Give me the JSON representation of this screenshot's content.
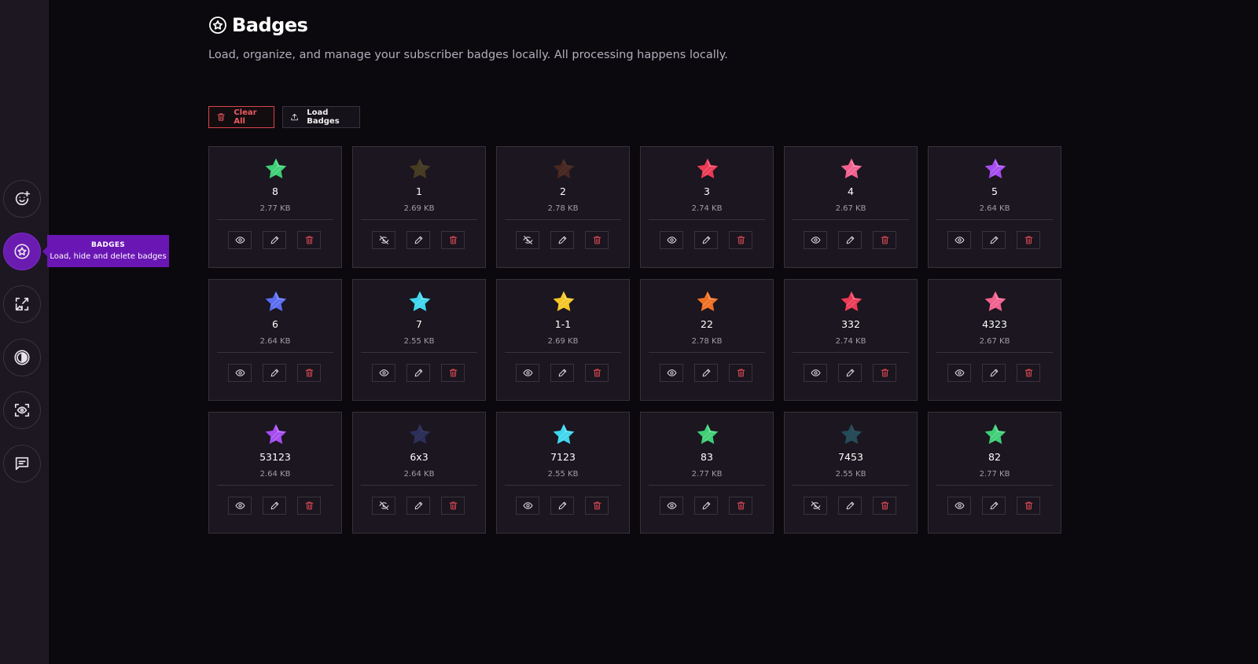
{
  "header": {
    "title": "Badges",
    "subtitle": "Load, organize, and manage your subscriber badges locally. All processing happens locally."
  },
  "toolbar": {
    "clear_label": "Clear All",
    "load_label": "Load Badges"
  },
  "tooltip": {
    "title": "BADGES",
    "subtitle": "Load, hide and delete badges"
  },
  "sidebar": {
    "items": [
      {
        "icon": "emoji-add-icon",
        "active": false
      },
      {
        "icon": "badge-star-icon",
        "active": true
      },
      {
        "icon": "image-resize-icon",
        "active": false
      },
      {
        "icon": "contrast-icon",
        "active": false
      },
      {
        "icon": "eye-scan-icon",
        "active": false
      },
      {
        "icon": "message-icon",
        "active": false
      }
    ]
  },
  "colors": {
    "accent": "#6a16b4",
    "danger": "#ee5a62",
    "background": "#0b090d",
    "card": "#1b161f"
  },
  "badges": [
    {
      "name": "8",
      "size": "2.77 KB",
      "color": "#3ecf76",
      "hidden": false
    },
    {
      "name": "1",
      "size": "2.69 KB",
      "color": "#b89a2a",
      "hidden": true
    },
    {
      "name": "2",
      "size": "2.78 KB",
      "color": "#c2582a",
      "hidden": true
    },
    {
      "name": "3",
      "size": "2.74 KB",
      "color": "#ec3a55",
      "hidden": false
    },
    {
      "name": "4",
      "size": "2.67 KB",
      "color": "#f2608e",
      "hidden": false
    },
    {
      "name": "5",
      "size": "2.64 KB",
      "color": "#a64cf0",
      "hidden": false
    },
    {
      "name": "6",
      "size": "2.64 KB",
      "color": "#5a6cf2",
      "hidden": false
    },
    {
      "name": "7",
      "size": "2.55 KB",
      "color": "#3ed6ee",
      "hidden": false
    },
    {
      "name": "1-1",
      "size": "2.69 KB",
      "color": "#f5c628",
      "hidden": false
    },
    {
      "name": "22",
      "size": "2.78 KB",
      "color": "#f07022",
      "hidden": false
    },
    {
      "name": "332",
      "size": "2.74 KB",
      "color": "#ec3a55",
      "hidden": false
    },
    {
      "name": "4323",
      "size": "2.67 KB",
      "color": "#f2608e",
      "hidden": false
    },
    {
      "name": "53123",
      "size": "2.64 KB",
      "color": "#a64cf0",
      "hidden": false
    },
    {
      "name": "6x3",
      "size": "2.64 KB",
      "color": "#5a6cf2",
      "hidden": true
    },
    {
      "name": "7123",
      "size": "2.55 KB",
      "color": "#3ed6ee",
      "hidden": false
    },
    {
      "name": "83",
      "size": "2.77 KB",
      "color": "#3ecf76",
      "hidden": false
    },
    {
      "name": "7453",
      "size": "2.55 KB",
      "color": "#3ed6ee",
      "hidden": true
    },
    {
      "name": "82",
      "size": "2.77 KB",
      "color": "#3ecf76",
      "hidden": false
    }
  ]
}
